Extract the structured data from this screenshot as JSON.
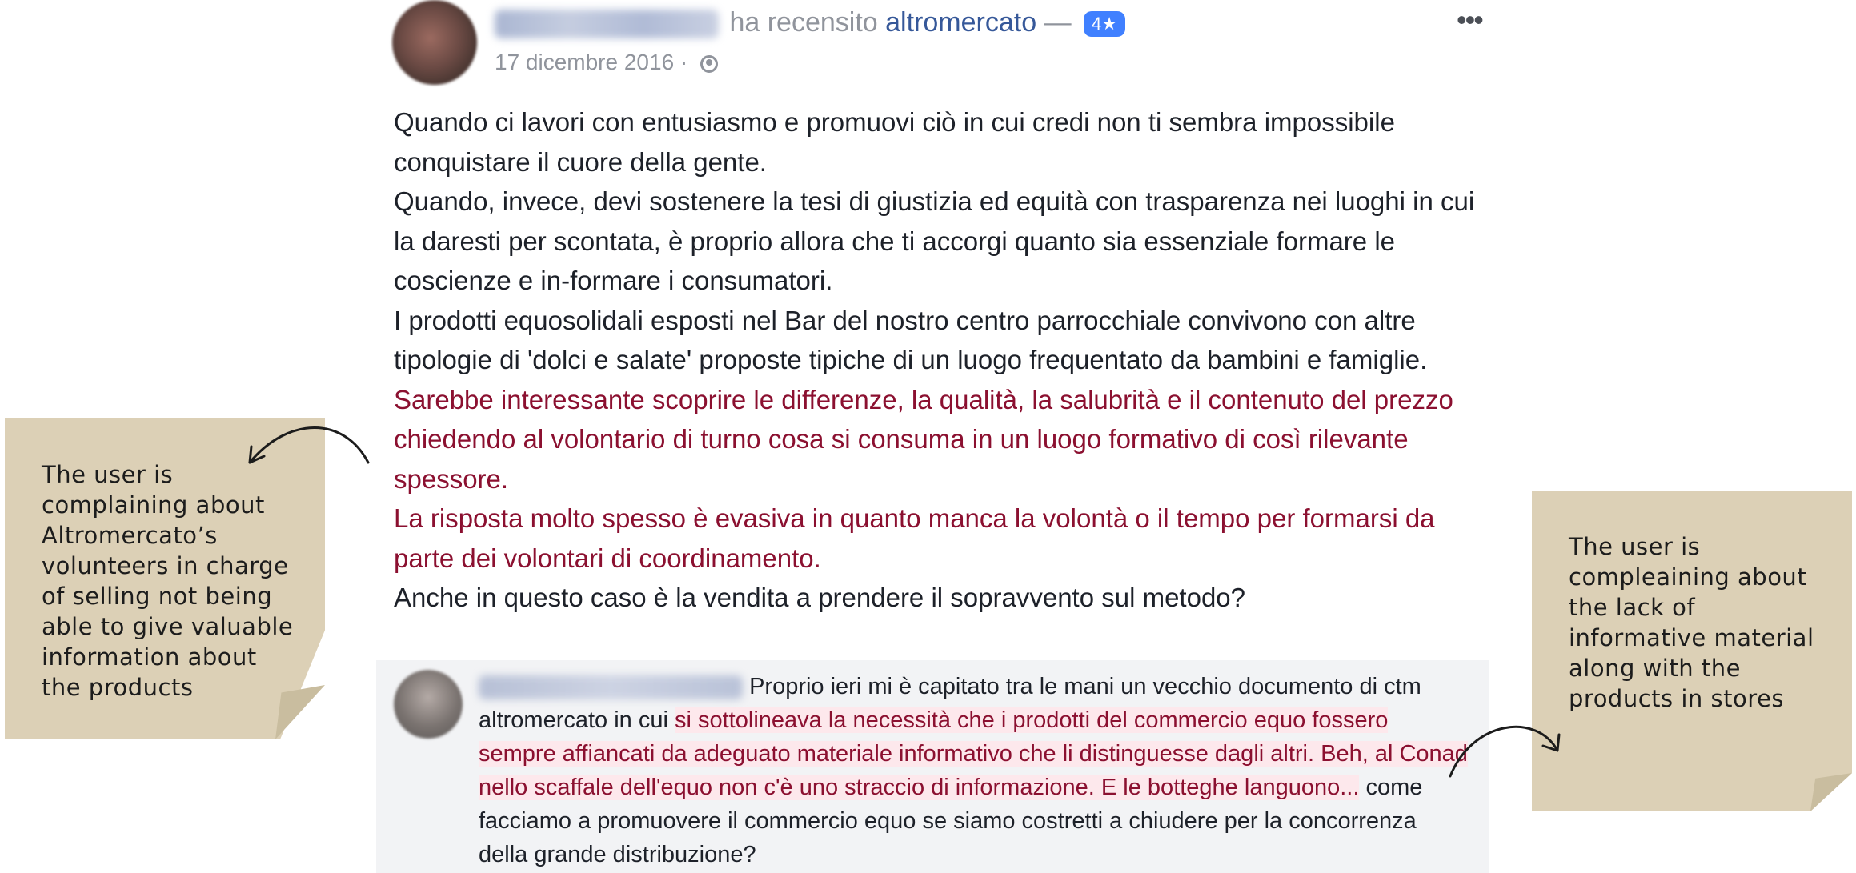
{
  "post": {
    "reviewed_text": "ha recensito",
    "page_name": "altromercato",
    "dash": "—",
    "rating": "4★",
    "date": "17 dicembre 2016 ·",
    "more_label": "•••",
    "paragraphs": [
      "Quando ci lavori con entusiasmo e promuovi ciò in cui credi non ti sembra impossibile conquistare il cuore della gente.",
      "Quando, invece, devi sostenere la tesi di giustizia ed equità con trasparenza nei luoghi in cui la daresti per scontata, è proprio allora che ti accorgi quanto sia essenziale formare le coscienze e in-formare i consumatori.",
      "I prodotti equosolidali esposti nel Bar del nostro centro parrocchiale convivono con altre tipologie di 'dolci e salate' proposte tipiche di un luogo frequentato da bambini e famiglie.",
      "Sarebbe interessante scoprire le differenze, la qualità, la salubrità e il contenuto del prezzo chiedendo al volontario di turno cosa si consuma in un luogo formativo di così rilevante spessore.",
      "La risposta molto spesso è evasiva in quanto manca la volontà o il tempo per formarsi da parte dei volontari di coordinamento.",
      "Anche in questo caso è la vendita a prendere il sopravvento sul metodo?"
    ]
  },
  "comment": {
    "part1": "Proprio ieri mi è capitato tra le mani un vecchio documento di ctm altromercato in cui ",
    "highlight": "si sottolineava la necessità che i prodotti del commercio equo fossero sempre affiancati da adeguato materiale informativo che li distinguesse dagli altri. Beh, al Conad nello scaffale dell'equo non c'è uno straccio di informazione. E le botteghe languono...",
    "part2": " come facciamo a promuovere il commercio equo se siamo costretti a chiudere per la concorrenza della grande distribuzione?"
  },
  "notes": {
    "left": "The user is complaining about Altromercato’s volunteers in charge of selling not being able to give valuable information about the products",
    "right": "The user is compleaining about the lack of informative material along with the products in stores"
  },
  "colors": {
    "link": "#365899",
    "highlight_text": "#8b1030",
    "note_bg": "#dcd0b6",
    "rating_bg": "#4080ff"
  }
}
